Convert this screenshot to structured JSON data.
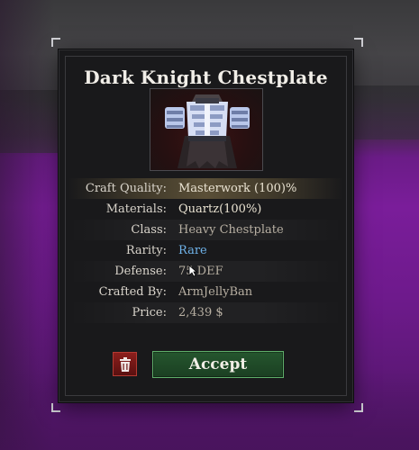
{
  "dialog": {
    "title": "Dark Knight Chestplate",
    "item_image_icon": "chestplate-armor-icon"
  },
  "stats": [
    {
      "label": "Craft Quality:",
      "value": "Masterwork (100)%",
      "style": "highlight"
    },
    {
      "label": "Materials:",
      "value": "Quartz(100%)",
      "style": "bright"
    },
    {
      "label": "Class:",
      "value": "Heavy Chestplate",
      "style": "normal"
    },
    {
      "label": "Rarity:",
      "value": "Rare",
      "style": "rare"
    },
    {
      "label": "Defense:",
      "value": "75 DEF",
      "style": "normal"
    },
    {
      "label": "Crafted By:",
      "value": "ArmJellyBan",
      "style": "normal"
    },
    {
      "label": "Price:",
      "value": "2,439 $",
      "style": "normal"
    }
  ],
  "actions": {
    "delete_icon": "trash-icon",
    "accept_label": "Accept"
  },
  "colors": {
    "rarity_rare": "#6fb3ea",
    "accept_border": "#5fae6a",
    "delete_bg": "#8c1f1c",
    "highlight_row": "#7d6c46"
  }
}
